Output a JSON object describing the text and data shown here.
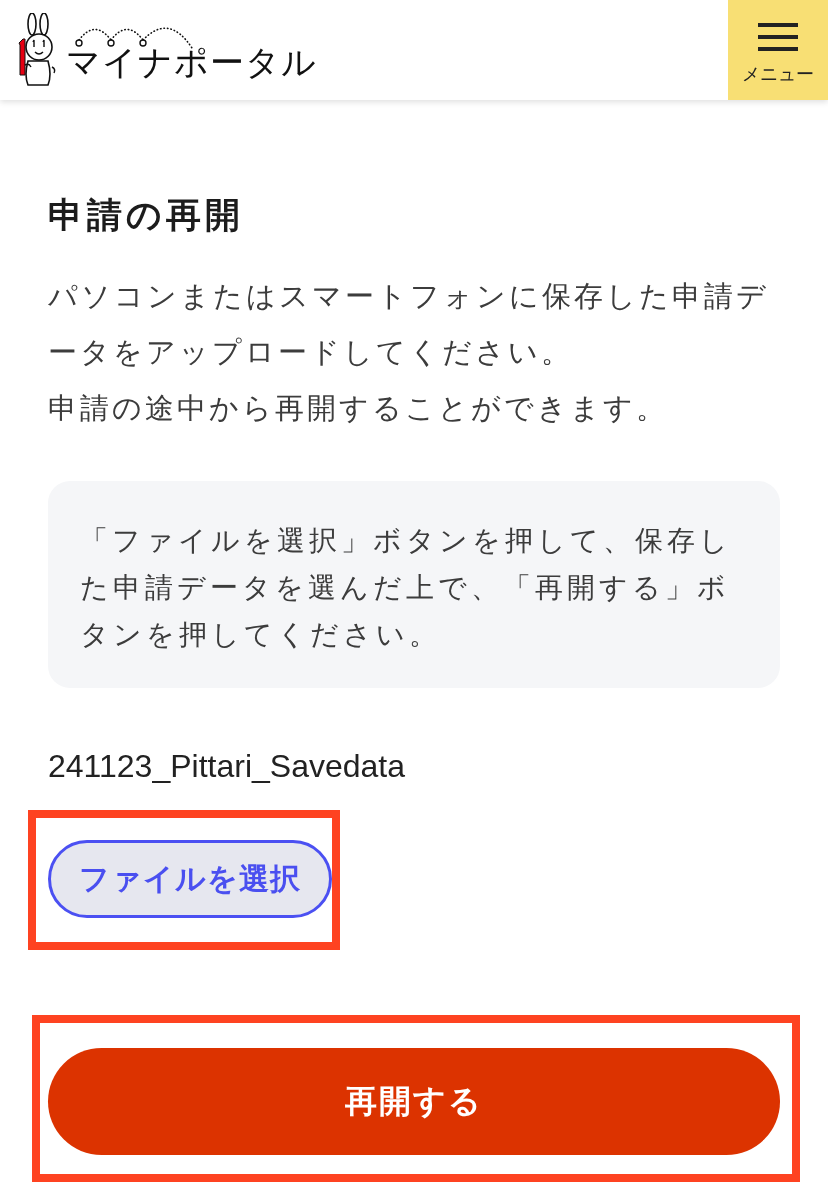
{
  "header": {
    "logo_text": "マイナポータル",
    "menu_button": {
      "label": "メニュー"
    }
  },
  "page": {
    "title": "申請の再開",
    "description": [
      "パソコンまたはスマートフォンに保存した申請データをアップロードしてください。",
      "申請の途中から再開することができます。"
    ],
    "notice": "「ファイルを選択」ボタンを押して、保存した申請データを選んだ上で、「再開する」ボタンを押してください。",
    "selected_file": "241123_Pittari_Savedata",
    "file_button": {
      "label": "ファイルを選択",
      "highlighted": true
    },
    "submit_button": {
      "label": "再開する",
      "highlighted": true
    }
  }
}
